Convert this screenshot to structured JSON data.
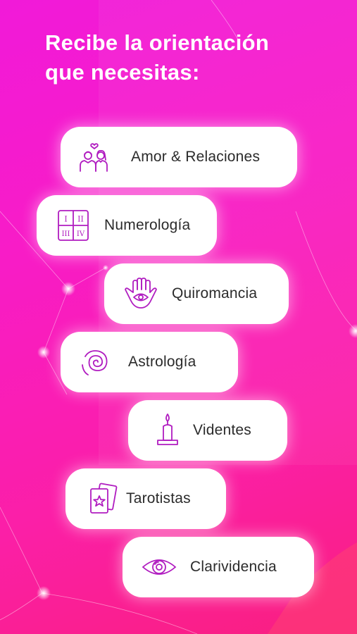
{
  "headline": {
    "line1": "Recibe la orientación",
    "line2": "que necesitas:"
  },
  "services": [
    {
      "label": "Amor & Relaciones",
      "icon": "couple-icon"
    },
    {
      "label": "Numerología",
      "icon": "numerology-grid-icon"
    },
    {
      "label": "Quiromancia",
      "icon": "hamsa-hand-icon"
    },
    {
      "label": "Astrología",
      "icon": "spiral-icon"
    },
    {
      "label": "Videntes",
      "icon": "candle-icon"
    },
    {
      "label": "Tarotistas",
      "icon": "tarot-cards-icon"
    },
    {
      "label": "Clarividencia",
      "icon": "eye-icon"
    }
  ],
  "numerology_numerals": [
    "I",
    "II",
    "III",
    "IV"
  ],
  "colors": {
    "accent": "#b01cc0",
    "background_start": "#f11ad9",
    "background_end": "#f91f7f"
  }
}
